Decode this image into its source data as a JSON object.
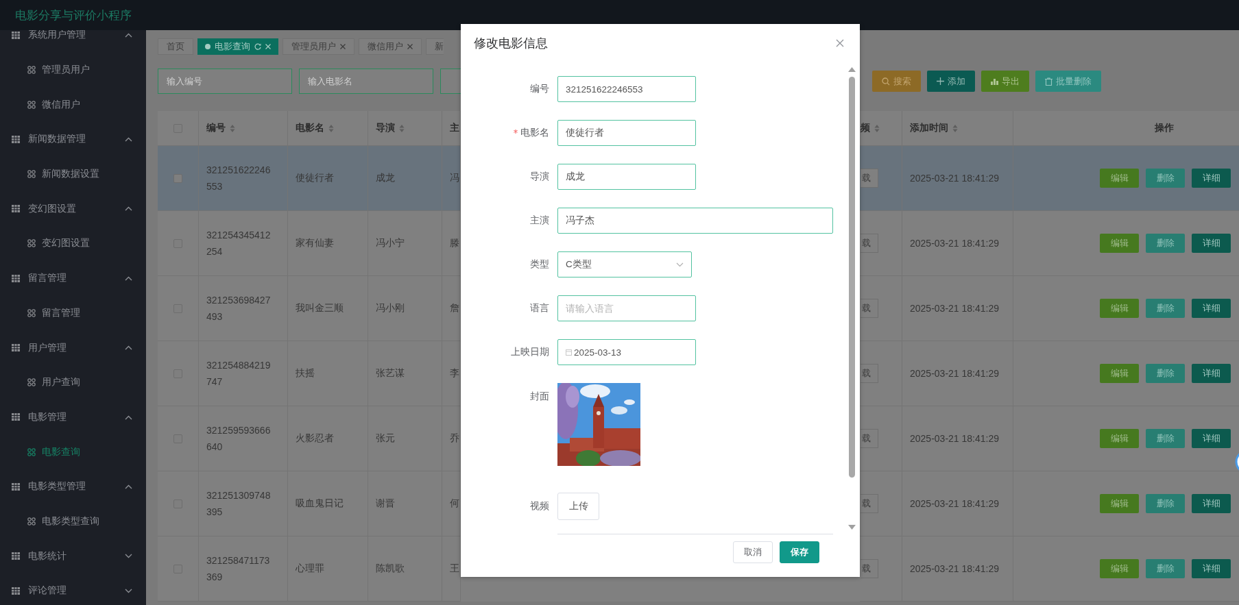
{
  "app": {
    "title": "电影分享与评价小程序"
  },
  "sidebar": {
    "groups": [
      {
        "label": "系统用户管理",
        "expanded": true,
        "children": [
          {
            "label": "管理员用户",
            "selected": false
          },
          {
            "label": "微信用户",
            "selected": false
          }
        ]
      },
      {
        "label": "新闻数据管理",
        "expanded": true,
        "children": [
          {
            "label": "新闻数据设置",
            "selected": false
          }
        ]
      },
      {
        "label": "变幻图设置",
        "expanded": true,
        "children": [
          {
            "label": "变幻图设置",
            "selected": false
          }
        ]
      },
      {
        "label": "留言管理",
        "expanded": true,
        "children": [
          {
            "label": "留言管理",
            "selected": false
          }
        ]
      },
      {
        "label": "用户管理",
        "expanded": true,
        "children": [
          {
            "label": "用户查询",
            "selected": false
          }
        ]
      },
      {
        "label": "电影管理",
        "expanded": true,
        "children": [
          {
            "label": "电影查询",
            "selected": true
          }
        ]
      },
      {
        "label": "电影类型管理",
        "expanded": true,
        "children": [
          {
            "label": "电影类型查询",
            "selected": false
          }
        ]
      },
      {
        "label": "电影统计",
        "expanded": false
      },
      {
        "label": "评论管理",
        "expanded": false
      }
    ]
  },
  "tabs": [
    {
      "label": "首页",
      "selected": false,
      "closable": false
    },
    {
      "label": "电影查询",
      "selected": true,
      "closable": true
    },
    {
      "label": "管理员用户",
      "selected": false,
      "closable": true
    },
    {
      "label": "微信用户",
      "selected": false,
      "closable": true
    },
    {
      "label": "新",
      "selected": false,
      "closable": false
    }
  ],
  "search": {
    "fields": [
      {
        "kind": "text",
        "placeholder": "输入编号"
      },
      {
        "kind": "text",
        "placeholder": "输入电影名"
      },
      {
        "kind": "text"
      }
    ],
    "buttons": [
      {
        "label": "搜索",
        "kind": "search"
      },
      {
        "label": "添加",
        "kind": "add"
      },
      {
        "label": "导出",
        "kind": "export"
      },
      {
        "label": "批量删除",
        "kind": "delete"
      }
    ]
  },
  "table": {
    "select_all": false,
    "columns_left": [
      {
        "label": "编号",
        "sortable": true
      },
      {
        "label": "电影名",
        "sortable": true
      },
      {
        "label": "导演",
        "sortable": true
      },
      {
        "label": "主",
        "sortable": false
      }
    ],
    "columns_right": [
      {
        "label": "频",
        "sortable": true
      },
      {
        "label": "添加时间",
        "sortable": true
      },
      {
        "label": "操作",
        "sortable": false
      }
    ],
    "rows": [
      {
        "checked": false,
        "highlighted": true,
        "id": "321251622246553",
        "name": "使徒行者",
        "director": "成龙",
        "lead": "冯",
        "video": "载",
        "added": "2025-03-21 18:41:29",
        "actions": [
          "编辑",
          "删除",
          "详细"
        ]
      },
      {
        "checked": false,
        "highlighted": false,
        "id": "321254345412254",
        "name": "家有仙妻",
        "director": "冯小宁",
        "lead": "滕",
        "video": "载",
        "added": "2025-03-21 18:41:29",
        "actions": [
          "编辑",
          "删除",
          "详细"
        ]
      },
      {
        "checked": false,
        "highlighted": false,
        "id": "321253698427493",
        "name": "我叫金三顺",
        "director": "冯小刚",
        "lead": "詹",
        "video": "载",
        "added": "2025-03-21 18:41:29",
        "actions": [
          "编辑",
          "删除",
          "详细"
        ]
      },
      {
        "checked": false,
        "highlighted": false,
        "id": "321254884219747",
        "name": "扶摇",
        "director": "张艺谋",
        "lead": "李",
        "video": "载",
        "added": "2025-03-21 18:41:29",
        "actions": [
          "编辑",
          "删除",
          "详细"
        ]
      },
      {
        "checked": false,
        "highlighted": false,
        "id": "321259593666640",
        "name": "火影忍者",
        "director": "张元",
        "lead": "乔",
        "video": "载",
        "added": "2025-03-21 18:41:29",
        "actions": [
          "编辑",
          "删除",
          "详细"
        ]
      },
      {
        "checked": false,
        "highlighted": false,
        "id": "321251309748395",
        "name": "吸血鬼日记",
        "director": "谢晋",
        "lead": "何",
        "video": "载",
        "added": "2025-03-21 18:41:29",
        "actions": [
          "编辑",
          "删除",
          "详细"
        ]
      },
      {
        "checked": false,
        "highlighted": false,
        "id": "321258471173369",
        "name": "心理罪",
        "director": "陈凯歌",
        "lead": "王",
        "video": "载",
        "added": "2025-03-21 18:41:29",
        "actions": [
          "编辑",
          "删除",
          "详细"
        ]
      }
    ]
  },
  "modal": {
    "title": "修改电影信息",
    "fields": [
      {
        "label": "编号",
        "kind": "text",
        "required": false,
        "value": "321251622246553"
      },
      {
        "label": "电影名",
        "kind": "text",
        "required": true,
        "value": "使徒行者"
      },
      {
        "label": "导演",
        "kind": "text",
        "required": false,
        "value": "成龙"
      },
      {
        "label": "主演",
        "kind": "longtext",
        "required": false,
        "value": "冯子杰"
      },
      {
        "label": "类型",
        "kind": "select",
        "required": false,
        "value": "C类型"
      },
      {
        "label": "语言",
        "kind": "text",
        "required": false,
        "placeholder": "请输入语言"
      },
      {
        "label": "上映日期",
        "kind": "date",
        "required": false,
        "value": "2025-03-13"
      },
      {
        "label": "封面",
        "required": false
      },
      {
        "label": "视频",
        "kind": "upload",
        "required": false,
        "button": "上传"
      }
    ],
    "buttons": [
      {
        "label": "取消",
        "kind": "cancel"
      },
      {
        "label": "保存",
        "kind": "primary"
      }
    ]
  }
}
